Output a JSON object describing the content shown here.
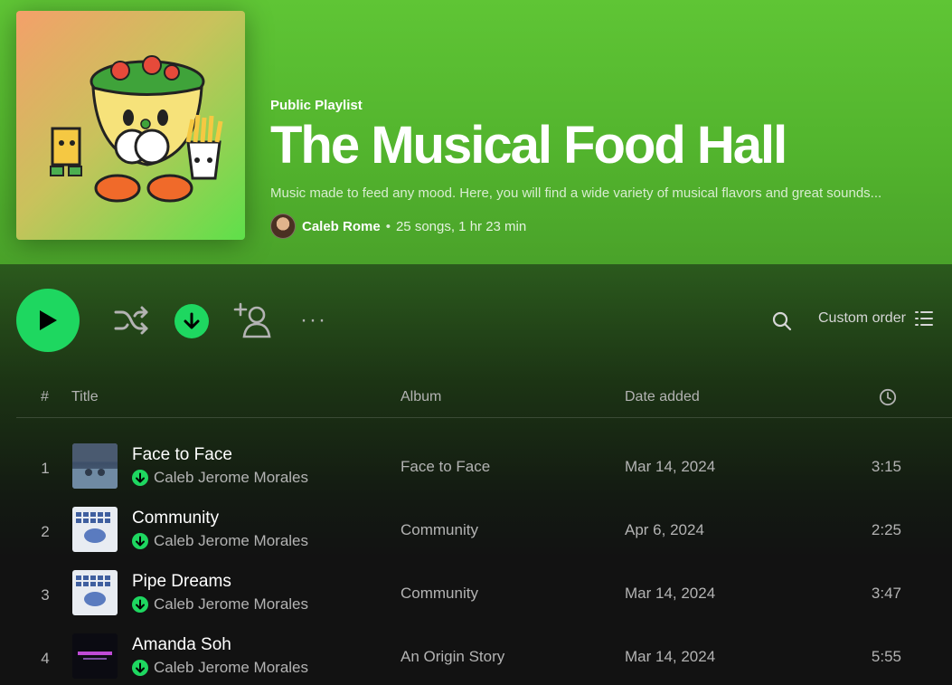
{
  "header": {
    "playlist_type": "Public Playlist",
    "title": "The Musical Food Hall",
    "description": "Music made to feed any mood. Here, you will find a wide variety of musical flavors and great sounds...",
    "owner": "Caleb Rome",
    "separator": "•",
    "stats": "25 songs, 1 hr 23 min",
    "cover_image": "salad-bowl-mascot-cover"
  },
  "actions": {
    "play_icon": "play-icon",
    "shuffle_icon": "shuffle-icon",
    "download_icon": "download-icon",
    "add_user_icon": "add-user-icon",
    "more_label": "···",
    "search_icon": "search-icon",
    "sort_label": "Custom order",
    "sort_icon": "list-icon"
  },
  "columns": {
    "number": "#",
    "title": "Title",
    "album": "Album",
    "date_added": "Date added",
    "duration_icon": "clock-icon"
  },
  "tracks": [
    {
      "number": "1",
      "title": "Face to Face",
      "artist": "Caleb Jerome Morales",
      "album": "Face to Face",
      "date_added": "Mar 14, 2024",
      "duration": "3:15"
    },
    {
      "number": "2",
      "title": "Community",
      "artist": "Caleb Jerome Morales",
      "album": "Community",
      "date_added": "Apr 6, 2024",
      "duration": "2:25"
    },
    {
      "number": "3",
      "title": "Pipe Dreams",
      "artist": "Caleb Jerome Morales",
      "album": "Community",
      "date_added": "Mar 14, 2024",
      "duration": "3:47"
    },
    {
      "number": "4",
      "title": "Amanda Soh",
      "artist": "Caleb Jerome Morales",
      "album": "An Origin Story",
      "date_added": "Mar 14, 2024",
      "duration": "5:55"
    }
  ],
  "colors": {
    "accent": "#1ed760",
    "header_bg": "#5fc535",
    "body_bg": "#121212"
  }
}
